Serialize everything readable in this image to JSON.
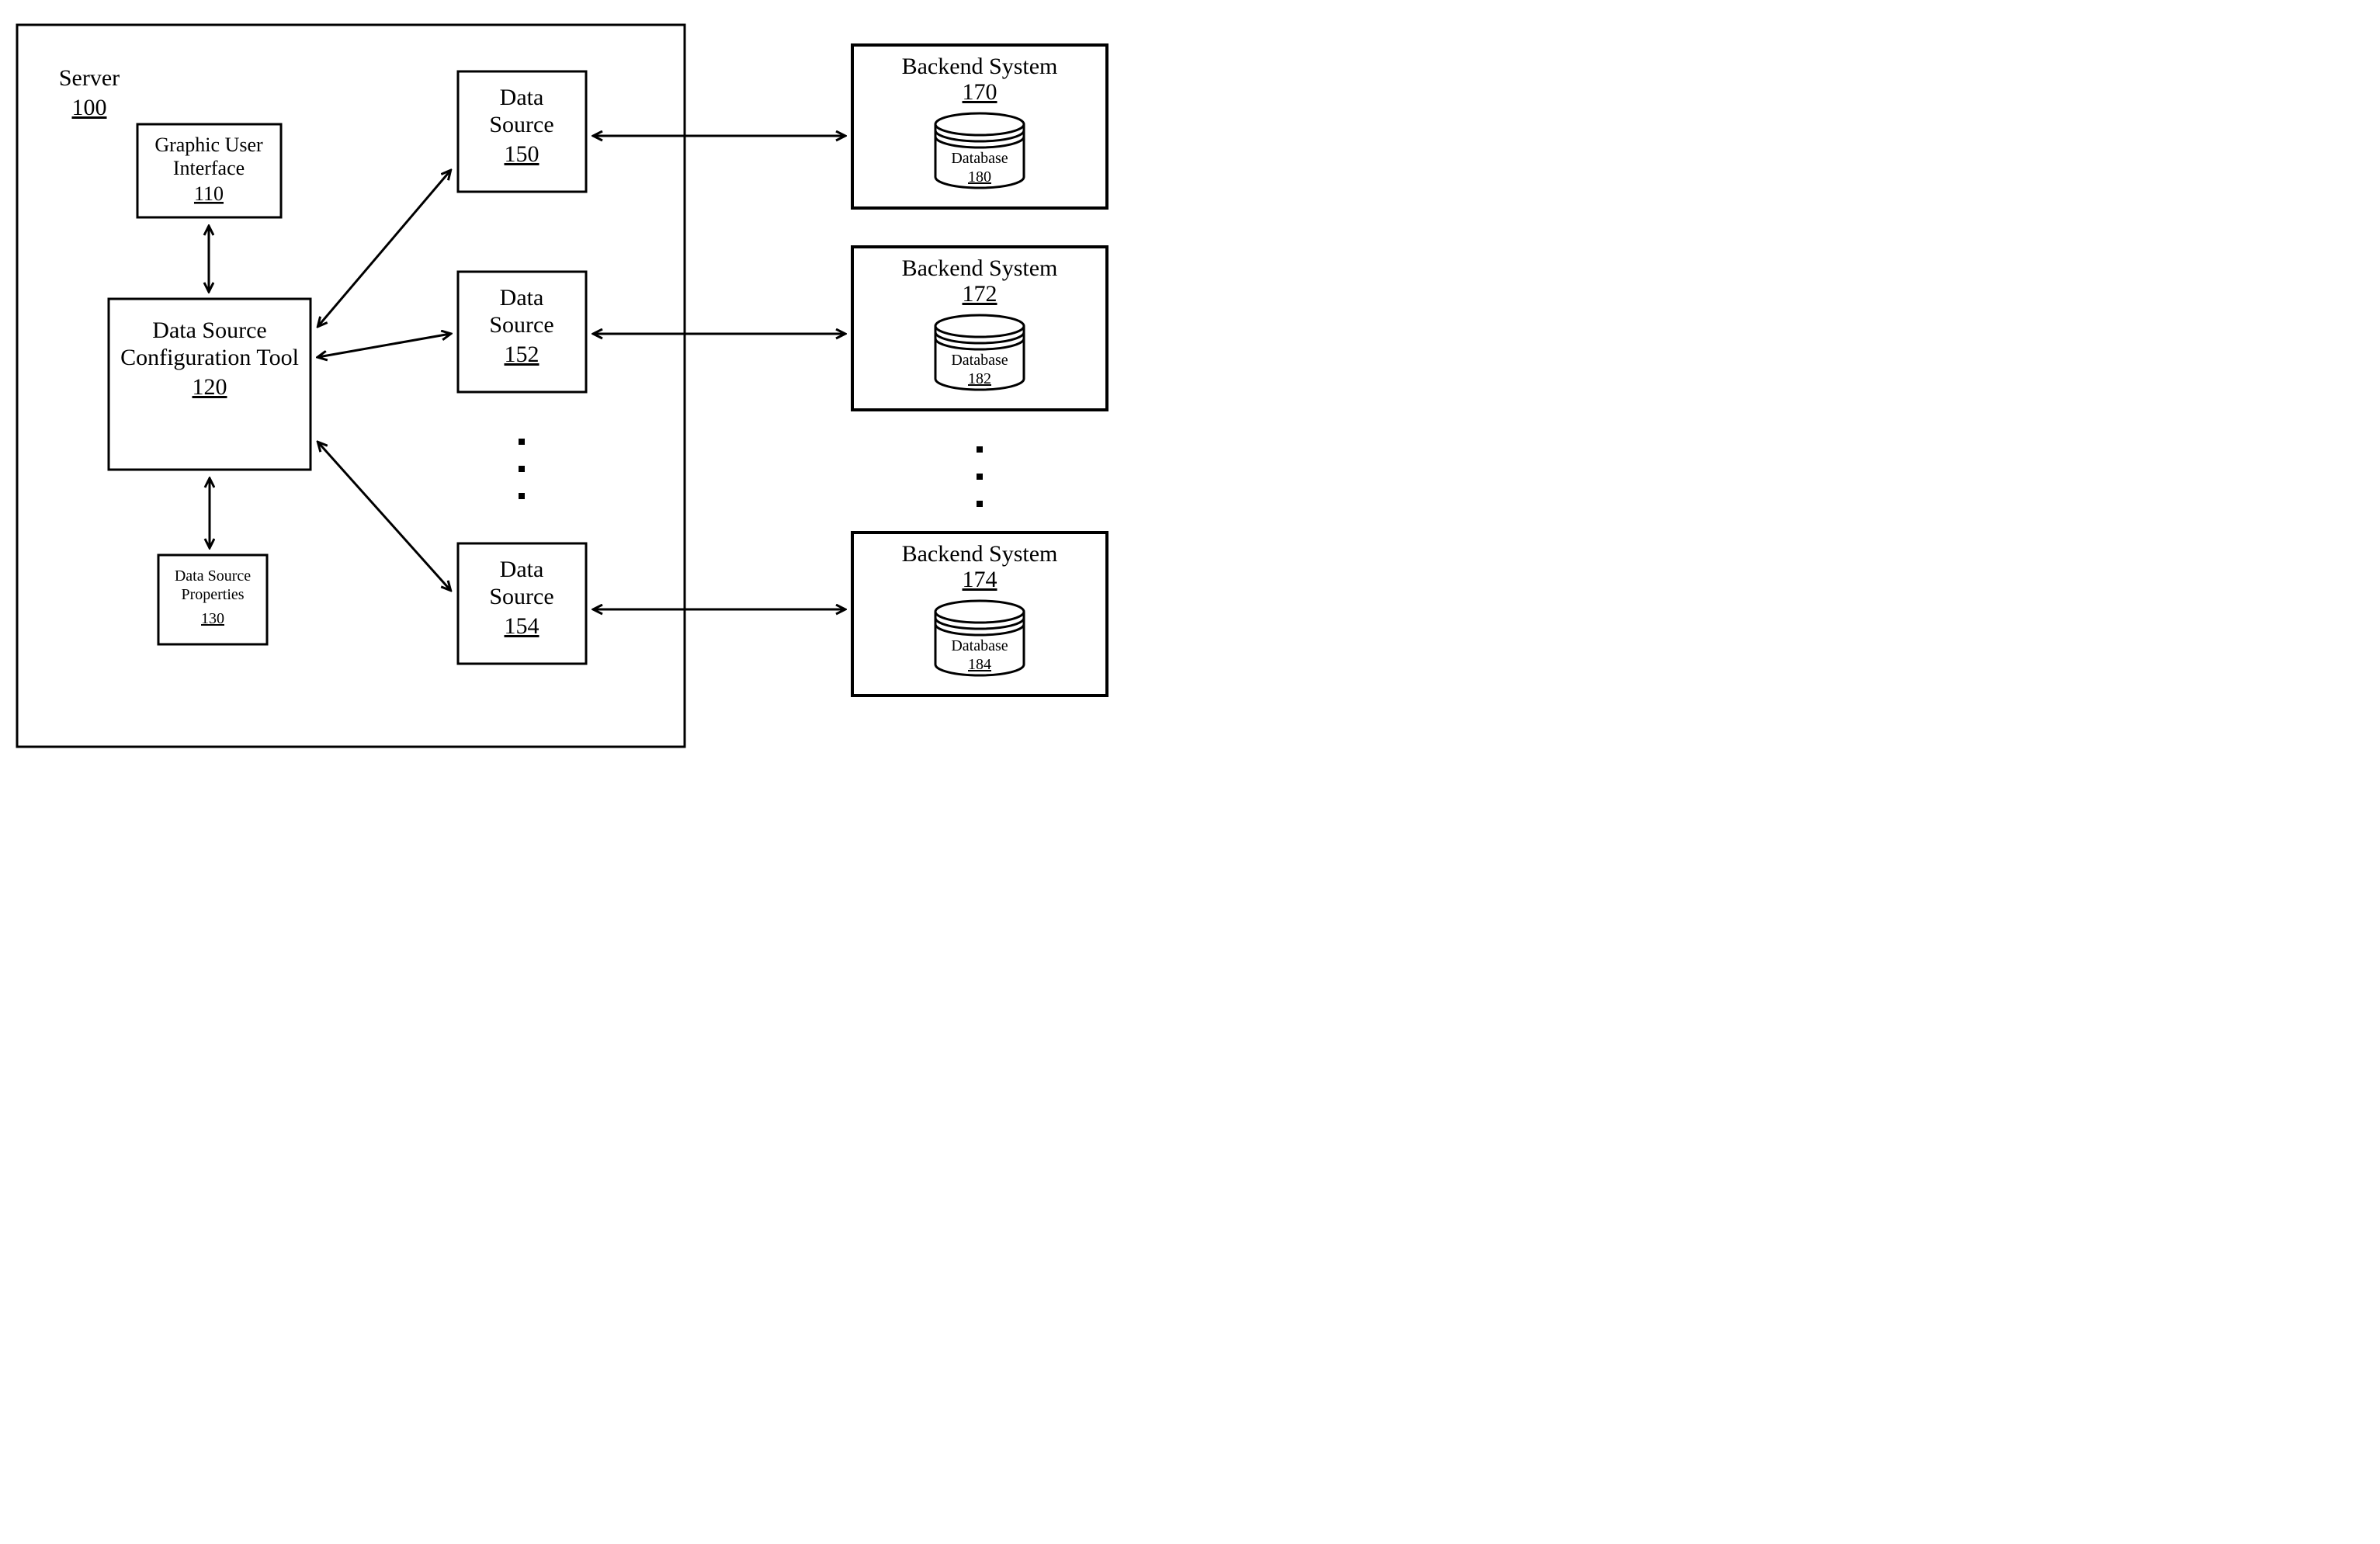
{
  "server": {
    "title": "Server",
    "id": "100"
  },
  "gui": {
    "title1": "Graphic User",
    "title2": "Interface",
    "id": "110"
  },
  "tool": {
    "title1": "Data Source",
    "title2": "Configuration Tool",
    "id": "120"
  },
  "props": {
    "title1": "Data Source",
    "title2": "Properties",
    "id": "130"
  },
  "ds": [
    {
      "title1": "Data",
      "title2": "Source",
      "id": "150"
    },
    {
      "title1": "Data",
      "title2": "Source",
      "id": "152"
    },
    {
      "title1": "Data",
      "title2": "Source",
      "id": "154"
    }
  ],
  "backend": [
    {
      "title": "Backend System",
      "id": "170",
      "db_label": "Database",
      "db_id": "180"
    },
    {
      "title": "Backend System",
      "id": "172",
      "db_label": "Database",
      "db_id": "182"
    },
    {
      "title": "Backend System",
      "id": "174",
      "db_label": "Database",
      "db_id": "184"
    }
  ]
}
